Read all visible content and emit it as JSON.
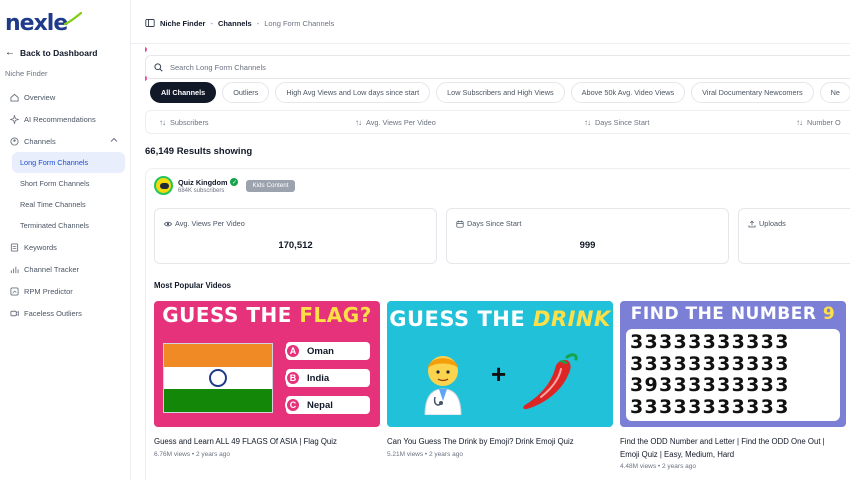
{
  "brand": {
    "logo_text": "nexle",
    "accent": "#1e3a8a",
    "swoosh_color": "#84cc16"
  },
  "sidebar": {
    "back_label": "Back to Dashboard",
    "section_label": "Niche Finder",
    "items": [
      {
        "label": "Overview",
        "icon": "home-icon"
      },
      {
        "label": "AI Recommendations",
        "icon": "sparkle-icon"
      },
      {
        "label": "Channels",
        "icon": "channels-icon",
        "expanded": true
      }
    ],
    "channel_subitems": [
      {
        "label": "Long Form Channels",
        "active": true
      },
      {
        "label": "Short Form Channels"
      },
      {
        "label": "Real Time Channels"
      },
      {
        "label": "Terminated Channels"
      }
    ],
    "more_items": [
      {
        "label": "Keywords",
        "icon": "keywords-icon"
      },
      {
        "label": "Channel Tracker",
        "icon": "tracker-icon"
      },
      {
        "label": "RPM Predictor",
        "icon": "rpm-icon"
      },
      {
        "label": "Faceless Outliers",
        "icon": "outliers-icon"
      }
    ]
  },
  "breadcrumb": {
    "part1": "Niche Finder",
    "sep1": "-",
    "part2": "Channels",
    "sep2": "-",
    "part3": "Long Form Channels"
  },
  "search": {
    "placeholder": "Search Long Form Channels"
  },
  "filters": [
    "All Channels",
    "Outliers",
    "High Avg Views and Low days since start",
    "Low Subscribers and High Views",
    "Above 50k Avg. Video Views",
    "Viral Documentary Newcomers",
    "Ne"
  ],
  "active_filter": "All Channels",
  "sort_columns": [
    "Subscribers",
    "Avg. Views Per Video",
    "Days Since Start",
    "Number O"
  ],
  "results_text": "66,149 Results showing",
  "channel": {
    "name": "Quiz Kingdom",
    "subscribers": "684K subscribers",
    "badge": "Kids Content",
    "stats": [
      {
        "title": "Avg. Views Per Video",
        "value": "170,512",
        "icon": "eye-icon"
      },
      {
        "title": "Days Since Start",
        "value": "999",
        "icon": "calendar-icon"
      },
      {
        "title": "Uploads",
        "value": "",
        "icon": "upload-icon"
      }
    ],
    "popular_title": "Most Popular Videos",
    "videos": [
      {
        "title": "Guess and Learn ALL 49 FLAGS Of ASIA | Flag Quiz",
        "meta": "6.76M views • 2 years ago",
        "thumb": {
          "head_a": "GUESS THE ",
          "head_b": "FLAG?",
          "options": [
            {
              "letter": "A",
              "text": "Oman"
            },
            {
              "letter": "B",
              "text": "India"
            },
            {
              "letter": "C",
              "text": "Nepal"
            }
          ]
        }
      },
      {
        "title": "Can You Guess The Drink by Emoji? Drink Emoji Quiz",
        "meta": "5.21M views • 2 years ago",
        "thumb": {
          "head_a": "GUESS THE ",
          "head_b": "DRINK",
          "plus": "+"
        }
      },
      {
        "title": "Find the ODD Number and Letter | Find the ODD One Out | Emoji Quiz | Easy, Medium, Hard",
        "meta": "4.48M views • 2 years ago",
        "thumb": {
          "head_a": "FIND THE NUMBER ",
          "head_b": "9",
          "lines": [
            "33333333333",
            "33333333333",
            "39333333333",
            "33333333333"
          ]
        }
      }
    ]
  }
}
